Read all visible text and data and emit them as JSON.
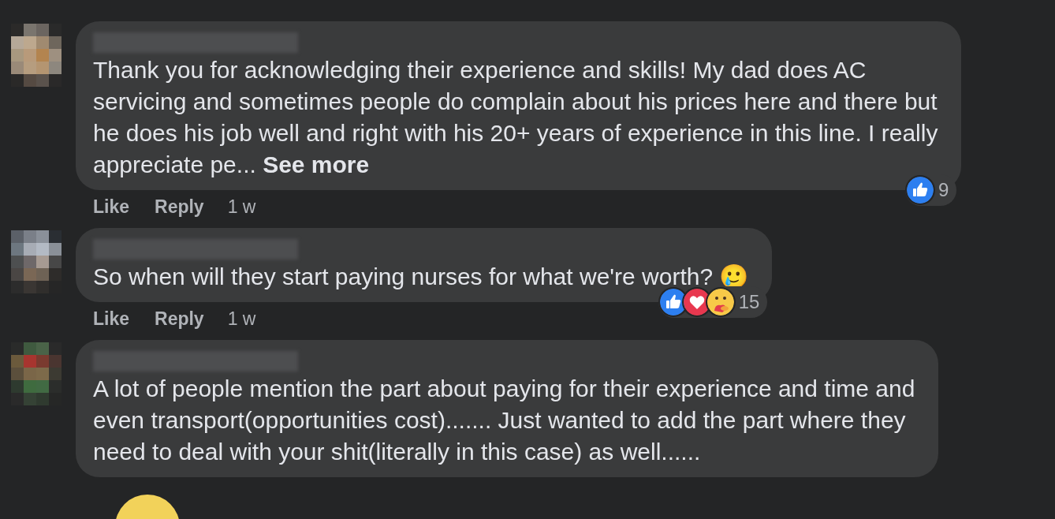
{
  "comments": [
    {
      "lines": [
        "Thank you for acknowledging their experience and skills! My dad does AC",
        "servicing and sometimes people do complain about his prices here and there but",
        "he does his job well and right with his 20+ years of experience in this line. I really",
        "appreciate pe..."
      ],
      "see_more": "See more",
      "actions": [
        "Like",
        "Reply"
      ],
      "time": "1 w",
      "reactions": [
        {
          "kind": "like"
        }
      ],
      "reaction_count": "9"
    },
    {
      "lines": [
        "So when will they start paying nurses for what we're worth? 🥲"
      ],
      "actions": [
        "Like",
        "Reply"
      ],
      "time": "1 w",
      "reactions": [
        {
          "kind": "like"
        },
        {
          "kind": "love"
        },
        {
          "kind": "care"
        }
      ],
      "reaction_count": "15"
    },
    {
      "lines": [
        "A lot of people mention the part about paying for their experience and time and",
        "even transport(opportunities cost)....... Just wanted to add the part where they",
        "need to deal with your shit(literally in this case) as well......"
      ]
    }
  ]
}
